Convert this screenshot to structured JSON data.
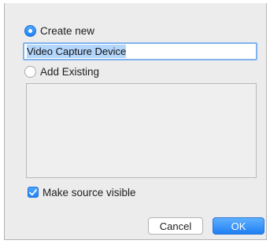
{
  "create_new": {
    "label": "Create new",
    "selected": true,
    "name_value": "Video Capture Device"
  },
  "add_existing": {
    "label": "Add Existing",
    "selected": false
  },
  "make_visible": {
    "label": "Make source visible",
    "checked": true
  },
  "buttons": {
    "cancel_label": "Cancel",
    "ok_label": "OK"
  },
  "colors": {
    "accent": "#1f82f6",
    "selection": "#b4d6fb",
    "dialog_bg": "#ececec"
  }
}
